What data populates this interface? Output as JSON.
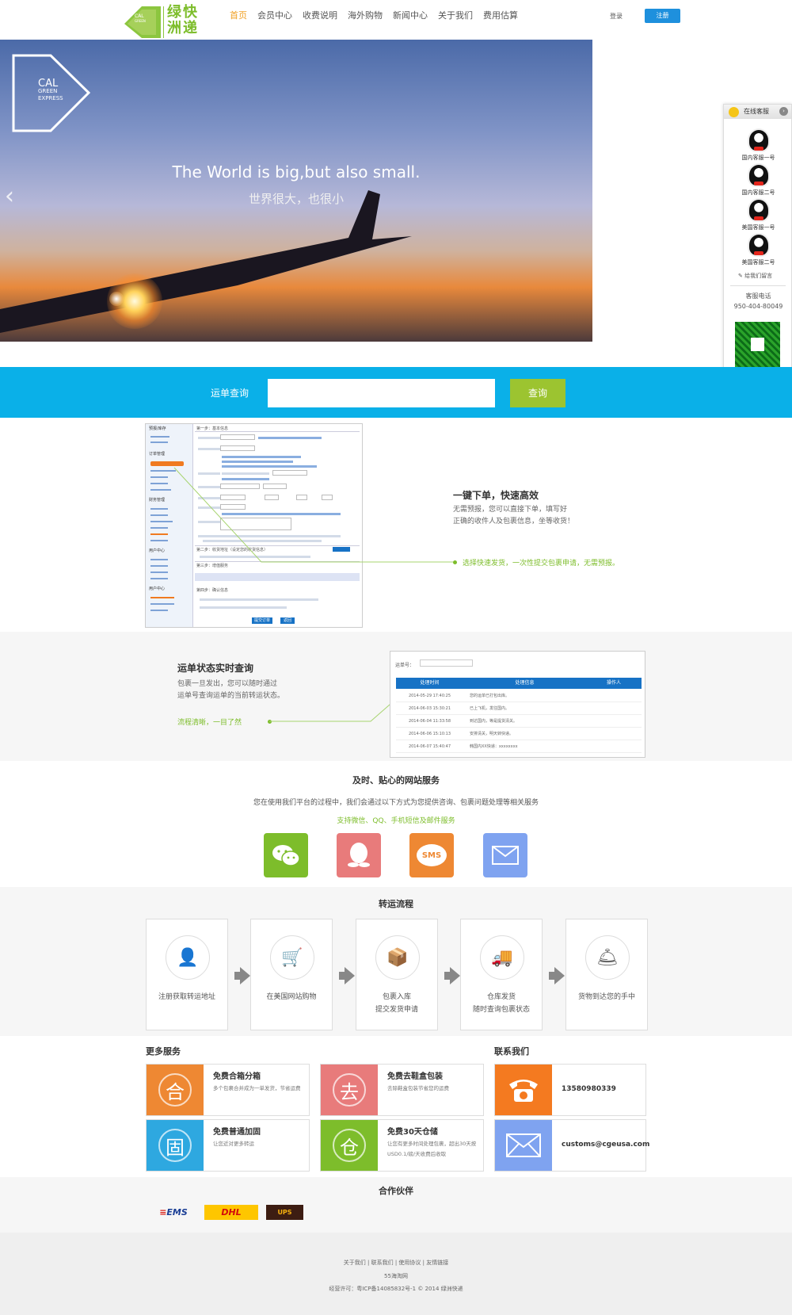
{
  "header": {
    "logo_en": [
      "CAL",
      "GREEN",
      "EXPRESS"
    ],
    "logo_cn_1": "绿快",
    "logo_cn_2": "洲递",
    "nav": [
      "首页",
      "会员中心",
      "收费说明",
      "海外购物",
      "新闻中心",
      "关于我们",
      "费用估算"
    ],
    "login": "登录",
    "register": "注册"
  },
  "banner": {
    "logo_en": [
      "CAL",
      "GREEN",
      "EXPRESS"
    ],
    "title": "The World is big,but also small.",
    "subtitle": "世界很大，也很小"
  },
  "cs_panel": {
    "title": "在线客服",
    "agents": [
      "国内客服一号",
      "国内客服二号",
      "美国客服一号",
      "美国客服二号"
    ],
    "message": "给我们留言",
    "tel_label": "客服电话",
    "tel": "950-404-80049"
  },
  "search": {
    "label": "运单查询",
    "button": "查询"
  },
  "order_section": {
    "title": "一键下单，快速高效",
    "text1": "无需预报，您可以直接下单，填写好",
    "text2": "正确的收件人及包裹信息，坐等收货！",
    "note": "选择快速发货，一次性提交包裹申请，无需预报。",
    "side_heads": [
      "预报/库存",
      "订单管理",
      "财务管理",
      "用户中心",
      "用户中心"
    ],
    "steps": [
      "第一步：基本信息",
      "第二步：收货地址（设定您的收货信息）",
      "第三步：增值服务",
      "第四步：确认信息"
    ],
    "buttons": [
      "提交订单",
      "返回"
    ]
  },
  "track_section": {
    "title": "运单状态实时查询",
    "text1": "包裹一旦发出，您可以随时通过",
    "text2": "运单号查询运单的当前转运状态。",
    "note": "流程清晰，一目了然",
    "no_label": "运单号：",
    "headers": [
      "处理时间",
      "处理信息",
      "操作人"
    ],
    "rows": [
      [
        "2014-05-29  17:40:25",
        "您的运单已打包出库。"
      ],
      [
        "2014-06-03  15:30:21",
        "已上飞机，发往国内。"
      ],
      [
        "2014-06-04  11:33:58",
        "到达国内，等是提货清关。"
      ],
      [
        "2014-06-06  15:10:13",
        "安排清关，明天转快递。"
      ],
      [
        "2014-06-07  15:40:47",
        "韩国内XX快递：xxxxxxxx"
      ]
    ]
  },
  "service": {
    "title": "及时、贴心的网站服务",
    "text": "您在使用我们平台的过程中，我们会通过以下方式为您提供咨询、包裹问题处理等相关服务",
    "note": "支持微信、QQ、手机短信及邮件服务",
    "icons": [
      {
        "name": "wechat-icon",
        "color": "#7dbd2b"
      },
      {
        "name": "qq-icon",
        "color": "#e87b7b"
      },
      {
        "name": "sms-icon",
        "color": "#ee8833",
        "label": "SMS"
      },
      {
        "name": "mail-icon",
        "color": "#7fa3f0"
      }
    ]
  },
  "flow": {
    "title": "转运流程",
    "steps": [
      [
        "注册获取转运地址"
      ],
      [
        "在美国网站购物"
      ],
      [
        "包裹入库",
        "提交发货申请"
      ],
      [
        "仓库发货",
        "随时查询包裹状态"
      ],
      [
        "货物到达您的手中"
      ]
    ]
  },
  "more": {
    "title": "更多服务",
    "cards": [
      {
        "char": "合",
        "title": "免费合箱分箱",
        "desc": "多个包裹合并成为一单发货，节省运费",
        "color": "#ee8833"
      },
      {
        "char": "去",
        "title": "免费去鞋盒包装",
        "desc": "去除鞋盒包装节省您的运费",
        "color": "#e87b7b"
      },
      {
        "char": "固",
        "title": "免费普通加固",
        "desc": "让您近对更多转运",
        "color": "#2ea8e0"
      },
      {
        "char": "仓",
        "title": "免费30天仓储",
        "desc": "让您有更多时间处理包裹，超出30天按USD0.1/磅/天收费后收取",
        "color": "#7dbd2b"
      }
    ]
  },
  "contact": {
    "title": "联系我们",
    "phone": "13580980339",
    "email": "customs@cgeusa.com",
    "phone_color": "#f47a20",
    "email_color": "#7fa3f0"
  },
  "partners": {
    "title": "合作伙伴",
    "logos": [
      "EMS",
      "DHL",
      "UPS"
    ]
  },
  "footer": {
    "links": [
      "关于我们",
      "联系我们",
      "使用协议",
      "友情链接"
    ],
    "line2": "55海淘网",
    "line3": "经营许可：粤ICP备14085832号-1 © 2014  绿洲快递"
  }
}
